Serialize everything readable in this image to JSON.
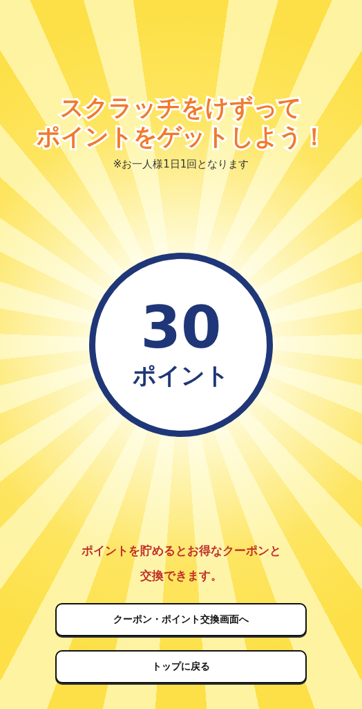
{
  "heading": {
    "lines": [
      "スクラッチをけずって",
      "ポイントをゲットしよう！"
    ],
    "note": "※お一人様1日1回となります"
  },
  "result": {
    "points": "30",
    "unit": "ポイント"
  },
  "message": [
    "ポイントを貯めるとお得なクーポンと",
    "交換できます。"
  ],
  "buttons": [
    {
      "label": "クーポン・ポイント交換画面へ"
    },
    {
      "label": "トップに戻る"
    }
  ]
}
